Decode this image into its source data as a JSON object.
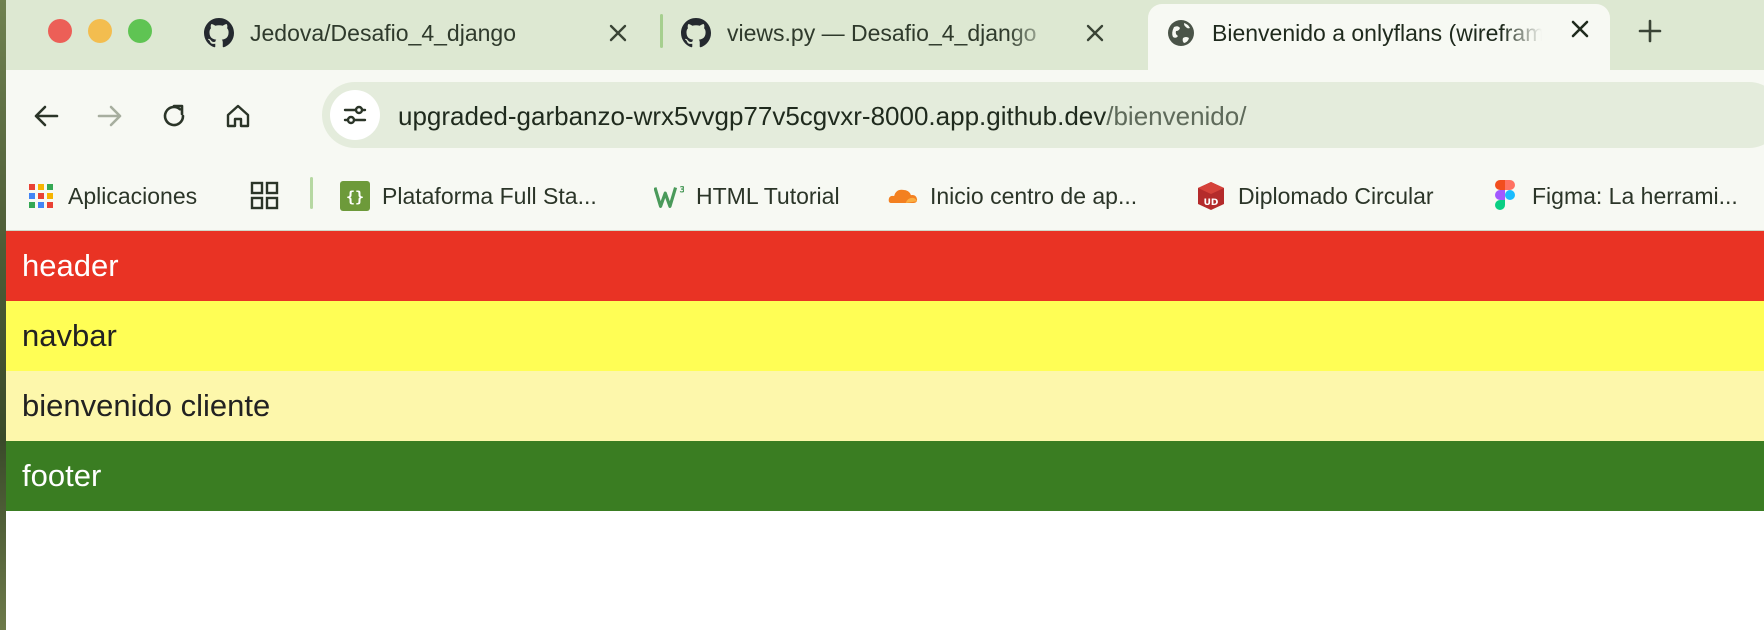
{
  "tabs": [
    {
      "title": "Jedova/Desafio_4_django",
      "icon": "github-icon",
      "active": false
    },
    {
      "title": "views.py — Desafio_4_django",
      "icon": "github-icon",
      "active": false
    },
    {
      "title": "Bienvenido a onlyflans (wireframe)",
      "icon": "globe-icon",
      "active": true
    }
  ],
  "address_bar": {
    "host": "upgraded-garbanzo-wrx5vvgp77v5cgvxr-8000.app.github.dev",
    "path": "/bienvenido/"
  },
  "bookmarks": [
    {
      "label": "Aplicaciones",
      "icon": "apps-grid-icon"
    },
    {
      "label": "Plataforma Full Sta...",
      "icon": "code-braces-icon"
    },
    {
      "label": "HTML Tutorial",
      "icon": "w3schools-icon"
    },
    {
      "label": "Inicio centro de ap...",
      "icon": "cloud-icon"
    },
    {
      "label": "Diplomado Circular",
      "icon": "udd-icon"
    },
    {
      "label": "Figma: La herrami...",
      "icon": "figma-icon"
    }
  ],
  "page": {
    "header": "header",
    "navbar": "navbar",
    "welcome": "bienvenido cliente",
    "footer": "footer"
  },
  "colors": {
    "header": "#e93324",
    "navbar": "#fffe55",
    "welcome": "#fdf7ab",
    "footer": "#3a7d22"
  }
}
